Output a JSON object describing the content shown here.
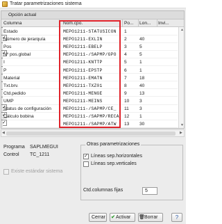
{
  "window": {
    "title": "Tratar parametrizaciones sistema"
  },
  "table": {
    "caption": "Opción actual",
    "columns": {
      "name": "Columna",
      "field": "Nom.cpo.",
      "pos": "Po...",
      "len": "Lon...",
      "inv": "Invi..."
    },
    "rows": [
      {
        "name": "Estado",
        "field": "MEPO1211-STATUSICON",
        "pos": "1",
        "len": "",
        "inv": false
      },
      {
        "name": "Número de jerarquía",
        "field": "MEPO1211-EXLIN",
        "pos": "2",
        "len": "40",
        "inv": true
      },
      {
        "name": "Pos",
        "field": "MEPO1211-EBELP",
        "pos": "3",
        "len": "5",
        "inv": false
      },
      {
        "name": "Nº pos.global",
        "field": "MEPO1211-/SAPMP/GPO",
        "pos": "4",
        "len": "5",
        "inv": true
      },
      {
        "name": "I",
        "field": "MEPO1211-KNTTP",
        "pos": "5",
        "len": "1",
        "inv": false
      },
      {
        "name": "P",
        "field": "MEPO1211-EPSTP",
        "pos": "6",
        "len": "1",
        "inv": false
      },
      {
        "name": "Material",
        "field": "MEPO1211-EMATN",
        "pos": "7",
        "len": "18",
        "inv": false
      },
      {
        "name": "Txt.brv.",
        "field": "MEPO1211-TXZ01",
        "pos": "8",
        "len": "40",
        "inv": false
      },
      {
        "name": "Ctd.pedido",
        "field": "MEPO1211-MENGE",
        "pos": "9",
        "len": "13",
        "inv": false
      },
      {
        "name": "UMP",
        "field": "MEPO1211-MEINS",
        "pos": "10",
        "len": "3",
        "inv": false
      },
      {
        "name": "Status de configuración",
        "field": "MEPO1211-/SAPMP/CE_",
        "pos": "11",
        "len": "3",
        "inv": true
      },
      {
        "name": "Cálculo bobina",
        "field": "MEPO1211-/SAPMP/RECA",
        "pos": "12",
        "len": "1",
        "inv": true
      },
      {
        "name": "",
        "field": "MEPO1211-/SAPMP/ATW",
        "pos": "13",
        "len": "30",
        "inv": true
      }
    ]
  },
  "info": {
    "program_label": "Programa",
    "program_value": "SAPLMEGUI",
    "control_label": "Control",
    "control_value": "TC_1211",
    "standard_label": "Existe estándar sistema"
  },
  "options": {
    "title": "Otras parametrizaciones",
    "h_lines_label": "Líneas sep.horizontales",
    "v_lines_label": "Líneas sep.verticales",
    "fixed_cols_label": "Ctd.columnas fijas",
    "fixed_cols_value": "5"
  },
  "buttons": {
    "close": "Cerrar",
    "activate": "Activar",
    "delete": "Borrar"
  },
  "icons": {
    "close": "close-icon",
    "activate": "activate-icon",
    "delete": "delete-icon",
    "help": "help-icon",
    "accent": "#e0222a"
  }
}
